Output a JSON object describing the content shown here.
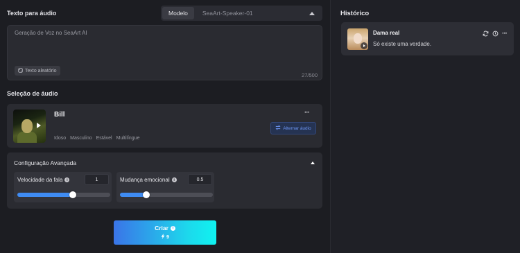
{
  "text_section": {
    "title": "Texto para áudio",
    "model_label": "Modelo",
    "model_value": "SeaArt-Speaker-01",
    "text_value": "Geração de Voz no SeaArt AI",
    "random_button": "Texto aleatório",
    "counter": "27/500"
  },
  "audio_section": {
    "title": "Seleção de áudio",
    "voice": {
      "name": "Bill",
      "tags": [
        "Idoso",
        "Masculino",
        "Estável",
        "Multilíngue"
      ]
    },
    "more": "···",
    "switch_button": "Alternar áudio"
  },
  "advanced": {
    "title": "Configuração Avançada",
    "speed": {
      "label": "Velocidade da fala",
      "value": "1",
      "fraction": 0.6
    },
    "emotion": {
      "label": "Mudança emocional",
      "value": "0.5",
      "fraction": 0.28
    }
  },
  "create": {
    "label": "Criar",
    "cost": "9"
  },
  "history": {
    "title": "Histórico",
    "items": [
      {
        "name": "Dama real",
        "text": "Só existe uma verdade."
      }
    ],
    "more": "···"
  },
  "colors": {
    "accent": "#3f8cf3",
    "switch_text": "#6e97f5"
  },
  "icons": [
    "caret-up-icon",
    "dice-icon",
    "play-icon",
    "info-icon",
    "lightning-icon",
    "refresh-icon",
    "clock-icon",
    "more-icon",
    "swap-icon"
  ]
}
